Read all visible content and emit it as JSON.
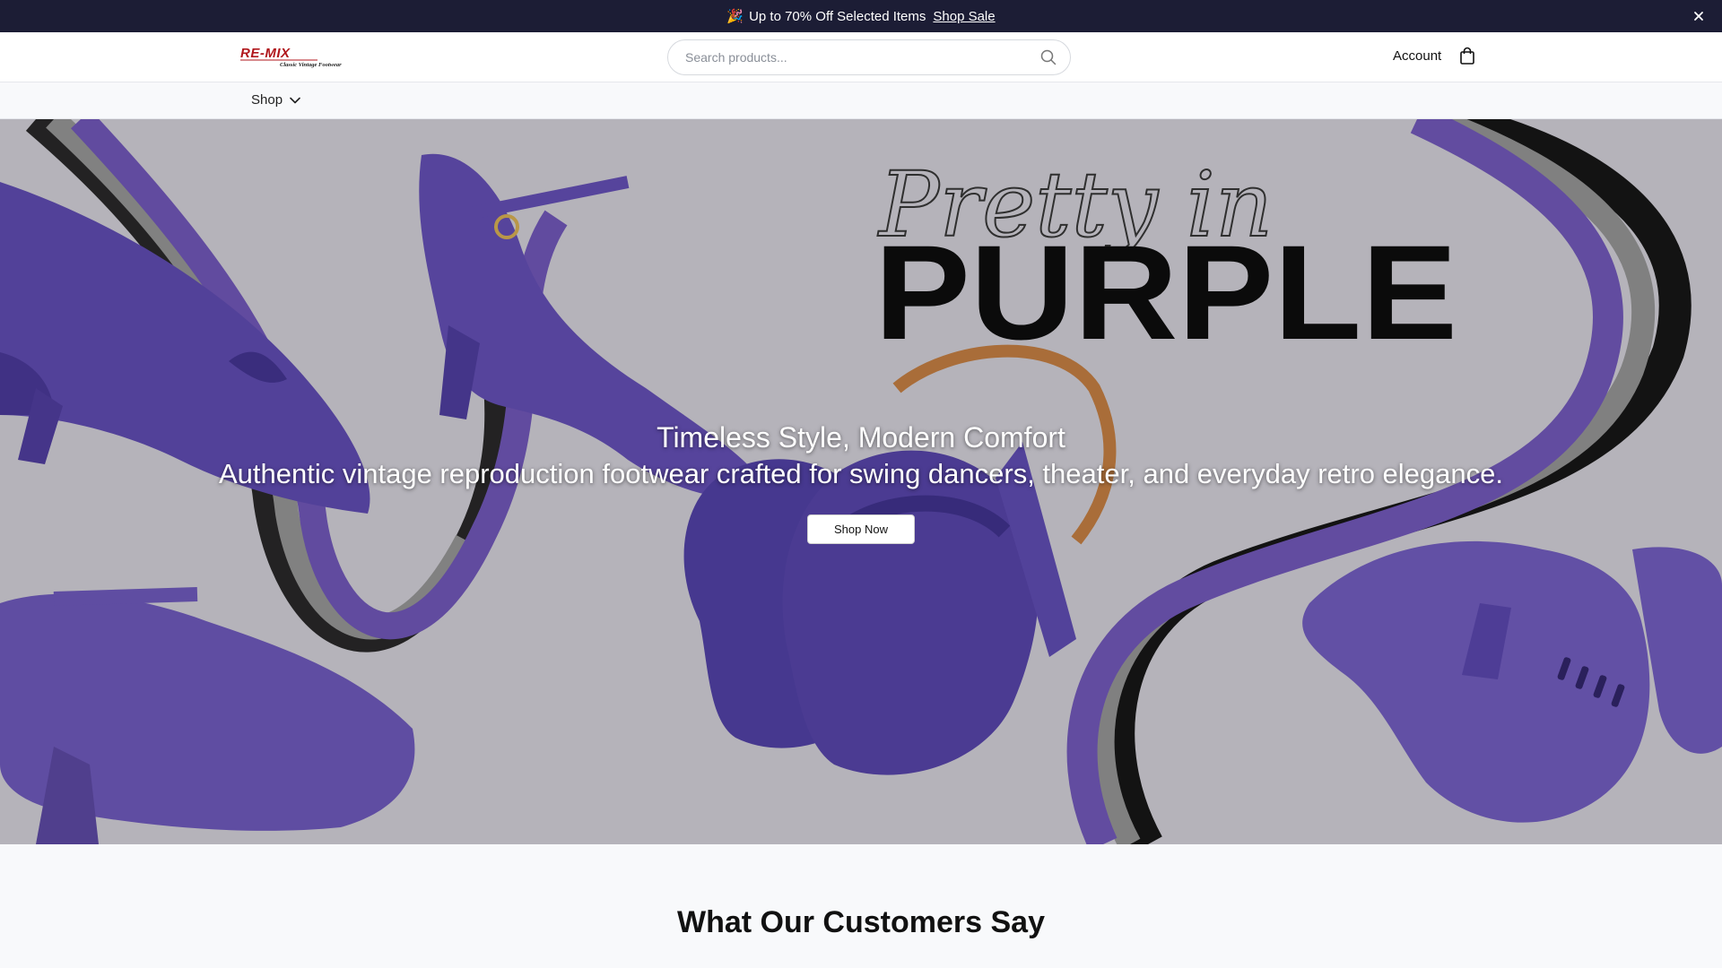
{
  "announcement": {
    "emoji": "🎉",
    "text": "Up to 70% Off Selected Items",
    "link_label": "Shop Sale",
    "close_icon": "close-icon"
  },
  "header": {
    "logo_text": "RE-MIX",
    "logo_tagline": "Classic Vintage Footwear",
    "search_placeholder": "Search products...",
    "search_icon": "search-icon",
    "account_label": "Account",
    "bag_icon": "shopping-bag-icon"
  },
  "nav": {
    "shop_label": "Shop",
    "shop_icon": "chevron-down-icon"
  },
  "hero": {
    "image_text_script": "Pretty in",
    "image_text_bold": "PURPLE",
    "title": "Timeless Style, Modern Comfort",
    "subtitle": "Authentic vintage reproduction footwear crafted for swing dancers, theater, and everyday retro elegance.",
    "button_label": "Shop Now"
  },
  "testimonials": {
    "heading": "What Our Customers Say"
  },
  "colors": {
    "announcement_bg": "#1c1d35",
    "shoe_purple": "#5a47a6",
    "logo_red": "#b0171c"
  }
}
